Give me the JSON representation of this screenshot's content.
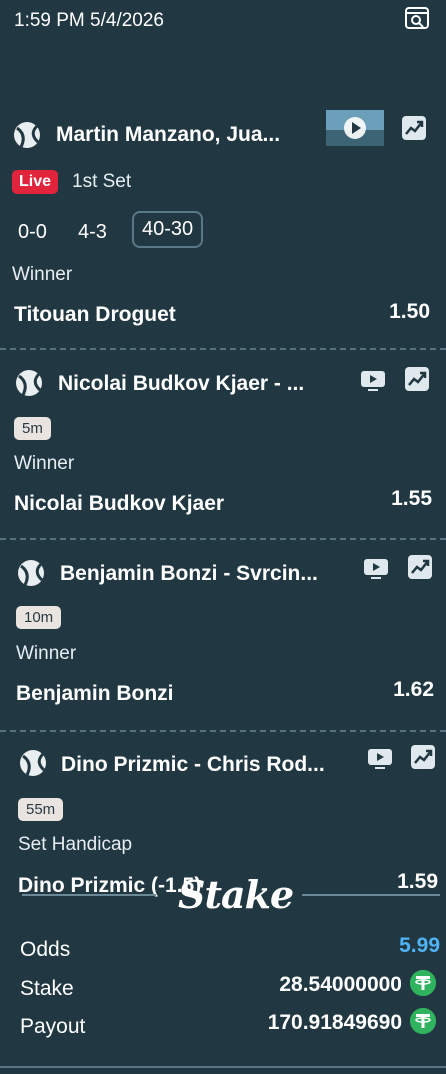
{
  "header": {
    "timestamp": "1:59 PM 5/4/2026"
  },
  "bets": [
    {
      "title": "Martin Manzano, Jua...",
      "live_label": "Live",
      "set_label": "1st Set",
      "scores": [
        "0-0",
        "4-3",
        "40-30"
      ],
      "market": "Winner",
      "selection": "Titouan Droguet",
      "odds": "1.50"
    },
    {
      "title": "Nicolai Budkov Kjaer - ...",
      "time": "5m",
      "market": "Winner",
      "selection": "Nicolai Budkov Kjaer",
      "odds": "1.55"
    },
    {
      "title": "Benjamin Bonzi - Svrcin...",
      "time": "10m",
      "market": "Winner",
      "selection": "Benjamin Bonzi",
      "odds": "1.62"
    },
    {
      "title": "Dino Prizmic - Chris Rod...",
      "time": "55m",
      "market": "Set Handicap",
      "selection": "Dino Prizmic (-1.5)",
      "odds": "1.59"
    }
  ],
  "brand": "Stake",
  "summary": {
    "odds_label": "Odds",
    "odds_value": "5.99",
    "stake_label": "Stake",
    "stake_value": "28.54000000",
    "payout_label": "Payout",
    "payout_value": "170.91849690"
  },
  "colors": {
    "background": "#213843",
    "live": "#e0243b",
    "odds_accent": "#4fb3f6",
    "coin": "#2fb35f"
  },
  "icons": [
    "search-icon",
    "tennis-ball-icon",
    "stream-icon",
    "stats-icon",
    "tether-icon"
  ]
}
